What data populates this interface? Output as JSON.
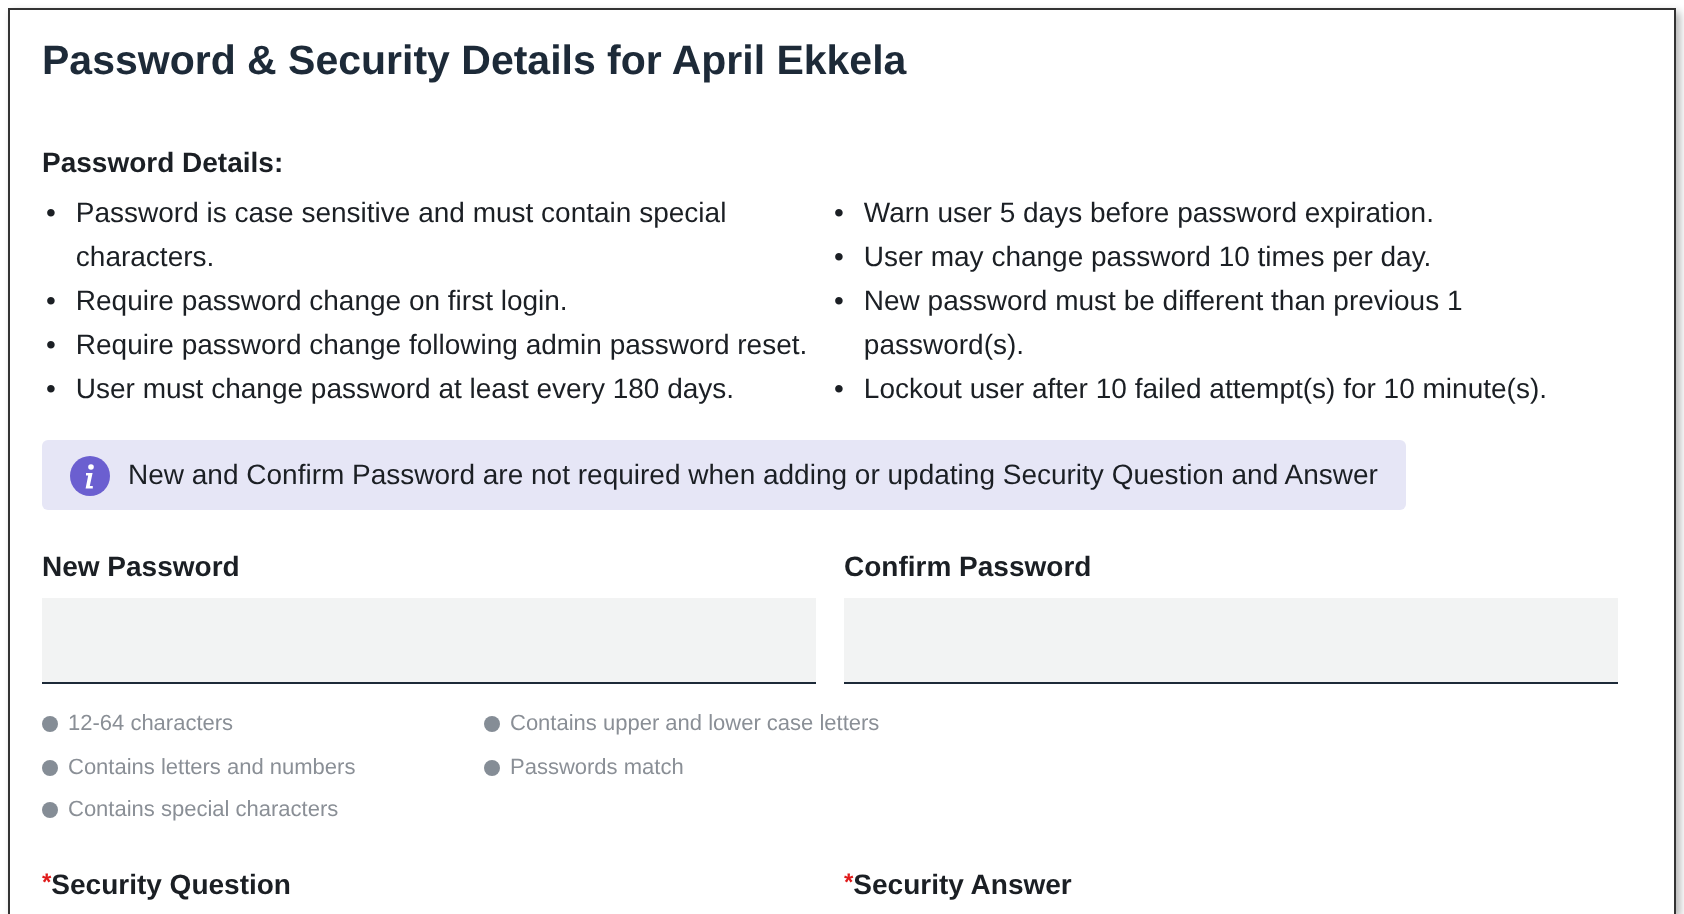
{
  "title": "Password & Security Details for April Ekkela",
  "details": {
    "heading": "Password Details:",
    "marker": "•",
    "columns": [
      [
        "Password is case sensitive and must contain special characters.",
        "Require password change on first login.",
        "Require password change following admin password reset.",
        "User must change password at least every 180 days."
      ],
      [
        "Warn user 5 days before password expiration.",
        "User may change password 10 times per day.",
        "New password must be different than previous 1 password(s).",
        "Lockout user after 10 failed attempt(s) for 10 minute(s)."
      ]
    ]
  },
  "info": {
    "text": "New and Confirm Password are not required when adding or updating Security Question and Answer"
  },
  "password_fields": [
    {
      "label": "New Password"
    },
    {
      "label": "Confirm Password"
    }
  ],
  "requirements": [
    {
      "text": "12-64 characters",
      "met": false
    },
    {
      "text": "Contains upper and lower case letters",
      "met": false
    },
    {
      "text": "Contains letters and numbers",
      "met": false
    },
    {
      "text": "Passwords match",
      "met": false
    },
    {
      "text": "Contains special characters",
      "met": false
    }
  ],
  "security_fields": [
    {
      "label": "Security Question",
      "required_mark": "*"
    },
    {
      "label": "Security Answer",
      "required_mark": "*"
    }
  ]
}
